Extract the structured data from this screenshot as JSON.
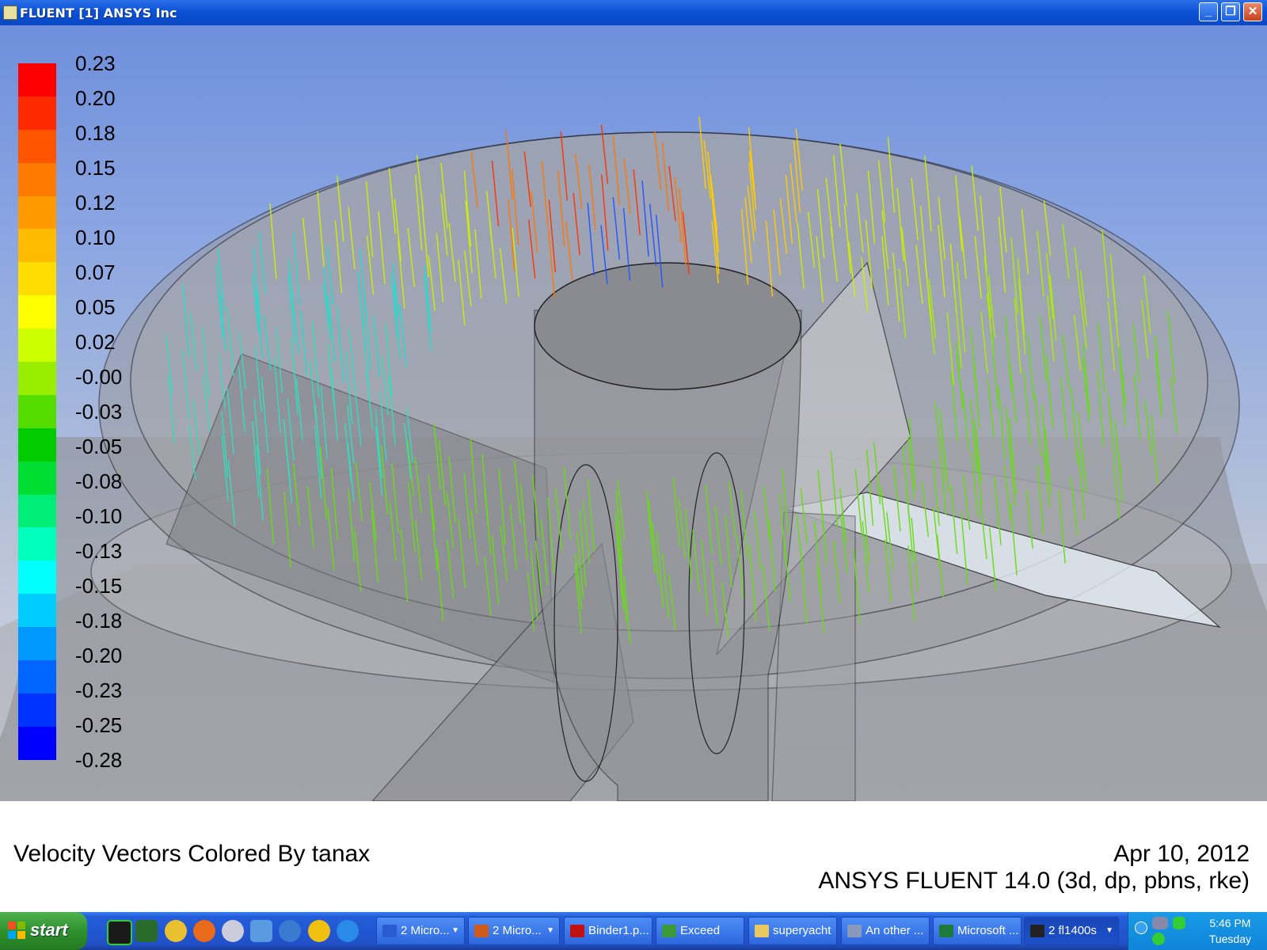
{
  "window": {
    "title": "FLUENT [1] ANSYS Inc",
    "buttons": [
      "_",
      "❐",
      "✕"
    ]
  },
  "colorbar": {
    "labels": [
      "0.23",
      "0.20",
      "0.18",
      "0.15",
      "0.12",
      "0.10",
      "0.07",
      "0.05",
      "0.02",
      "-0.00",
      "-0.03",
      "-0.05",
      "-0.08",
      "-0.10",
      "-0.13",
      "-0.15",
      "-0.18",
      "-0.20",
      "-0.23",
      "-0.25",
      "-0.28"
    ],
    "colors": [
      "#ff0000",
      "#ff2a00",
      "#ff5500",
      "#ff7a00",
      "#ff9900",
      "#ffbb00",
      "#ffdd00",
      "#ffff00",
      "#ccff00",
      "#99ee00",
      "#55dd00",
      "#00cc00",
      "#00dd33",
      "#00ee77",
      "#00ffbb",
      "#00ffff",
      "#00ccff",
      "#0099ff",
      "#0066ff",
      "#0033ff",
      "#0000ff"
    ]
  },
  "footer": {
    "caption": "Velocity Vectors Colored By tanax",
    "date": "Apr 10, 2012",
    "version": "ANSYS FLUENT 14.0 (3d, dp, pbns, rke)"
  },
  "taskbar": {
    "start_label": "start",
    "items": [
      {
        "label": "2 Micro...",
        "icon_color": "#2b5bd0",
        "icon": "word-icon"
      },
      {
        "label": "2 Micro...",
        "icon_color": "#d05a1a",
        "icon": "powerpoint-icon"
      },
      {
        "label": "Binder1.p...",
        "icon_color": "#c01010",
        "icon": "pdf-icon"
      },
      {
        "label": "Exceed",
        "icon_color": "#3a9a3a",
        "icon": "exceed-icon"
      },
      {
        "label": "superyacht",
        "icon_color": "#e8c860",
        "icon": "folder-icon"
      },
      {
        "label": "An other ...",
        "icon_color": "#8899bb",
        "icon": "printer-icon"
      },
      {
        "label": "Microsoft ...",
        "icon_color": "#1d7a3a",
        "icon": "excel-icon"
      },
      {
        "label": "2 fl1400s",
        "icon_color": "#222222",
        "icon": "fluent-icon"
      }
    ],
    "clock_time": "5:46 PM",
    "clock_day": "Tuesday"
  }
}
